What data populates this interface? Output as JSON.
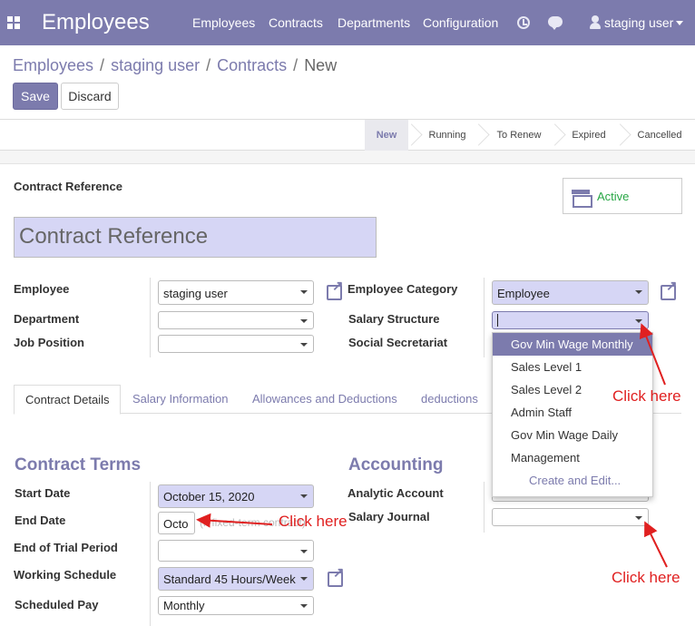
{
  "app": {
    "title": "Employees"
  },
  "nav": {
    "items": [
      "Employees",
      "Contracts",
      "Departments",
      "Configuration"
    ],
    "user": "staging user"
  },
  "breadcrumb": [
    "Employees",
    "staging user",
    "Contracts",
    "New"
  ],
  "buttons": {
    "save": "Save",
    "discard": "Discard"
  },
  "statusbar": {
    "stages": [
      "New",
      "Running",
      "To Renew",
      "Expired",
      "Cancelled"
    ],
    "current": "New"
  },
  "form": {
    "reference_label": "Contract Reference",
    "reference_placeholder": "Contract Reference",
    "active_label": "Active",
    "employee_label": "Employee",
    "employee_value": "staging user",
    "department_label": "Department",
    "job_position_label": "Job Position",
    "employee_category_label": "Employee Category",
    "employee_category_value": "Employee",
    "salary_structure_label": "Salary Structure",
    "social_secretariat_label": "Social Secretariat"
  },
  "tabs": [
    "Contract Details",
    "Salary Information",
    "Allowances and Deductions",
    "deductions"
  ],
  "contract_terms": {
    "title": "Contract Terms",
    "start_date_label": "Start Date",
    "start_date_value": "October 15, 2020",
    "end_date_label": "End Date",
    "end_date_value": "Octo",
    "end_date_hint": "(if fixed-term contract)",
    "trial_label": "End of Trial Period",
    "schedule_label": "Working Schedule",
    "schedule_value": "Standard 45 Hours/Week",
    "scheduled_pay_label": "Scheduled Pay",
    "scheduled_pay_value": "Monthly"
  },
  "accounting": {
    "title": "Accounting",
    "analytic_label": "Analytic Account",
    "journal_label": "Salary Journal"
  },
  "dropdown": {
    "items": [
      "Gov Min Wage Monthly",
      "Sales Level 1",
      "Sales Level 2",
      "Admin Staff",
      "Gov Min Wage Daily",
      "Management"
    ],
    "create": "Create and Edit..."
  },
  "annotations": {
    "click_here": "Click here"
  },
  "colors": {
    "brand": "#7c7bad",
    "required": "#d6d6f5",
    "annotation": "#e02020",
    "active": "#28a745"
  }
}
